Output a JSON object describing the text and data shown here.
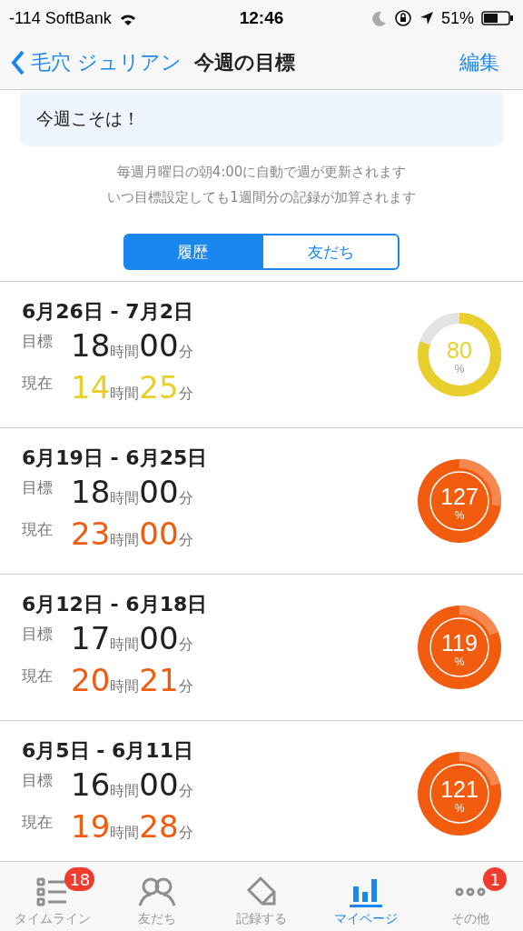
{
  "status_bar": {
    "carrier": "-114 SoftBank",
    "time": "12:46",
    "battery": "51%"
  },
  "nav": {
    "back": "毛穴 ジュリアン",
    "title": "今週の目標",
    "action": "編集"
  },
  "motto": "今週こそは！",
  "notice": [
    "毎週月曜日の朝4:00に自動で週が更新されます",
    "いつ目標設定しても1週間分の記録が加算されます"
  ],
  "segments": [
    {
      "label": "履歴",
      "selected": true
    },
    {
      "label": "友だち",
      "selected": false
    }
  ],
  "weeks": [
    {
      "range": "6月26日 - 7月2日",
      "goal_label": "目標",
      "goal_h": "18",
      "h_unit": "時間",
      "goal_m": "00",
      "m_unit": "分",
      "now_label": "現在",
      "now_h": "14",
      "now_h_unit": "時間",
      "now_m": "25",
      "now_m_unit": "分",
      "kind": "under",
      "percent": "80",
      "pct": "%"
    },
    {
      "range": "6月19日 - 6月25日",
      "goal_label": "目標",
      "goal_h": "18",
      "h_unit": "時間",
      "goal_m": "00",
      "m_unit": "分",
      "now_label": "現在",
      "now_h": "23",
      "now_h_unit": "時間",
      "now_m": "00",
      "now_m_unit": "分",
      "kind": "over",
      "percent": "127",
      "pct": "%"
    },
    {
      "range": "6月12日 - 6月18日",
      "goal_label": "目標",
      "goal_h": "17",
      "h_unit": "時間",
      "goal_m": "00",
      "m_unit": "分",
      "now_label": "現在",
      "now_h": "20",
      "now_h_unit": "時間",
      "now_m": "21",
      "now_m_unit": "分",
      "kind": "over",
      "percent": "119",
      "pct": "%"
    },
    {
      "range": "6月5日 - 6月11日",
      "goal_label": "目標",
      "goal_h": "16",
      "h_unit": "時間",
      "goal_m": "00",
      "m_unit": "分",
      "now_label": "現在",
      "now_h": "19",
      "now_h_unit": "時間",
      "now_m": "28",
      "now_m_unit": "分",
      "kind": "over",
      "percent": "121",
      "pct": "%"
    }
  ],
  "tabs": [
    {
      "label": "タイムライン",
      "badge": "18",
      "selected": false
    },
    {
      "label": "友だち",
      "selected": false
    },
    {
      "label": "記録する",
      "selected": false
    },
    {
      "label": "マイページ",
      "selected": true
    },
    {
      "label": "その他",
      "badge": "1",
      "selected": false
    }
  ]
}
